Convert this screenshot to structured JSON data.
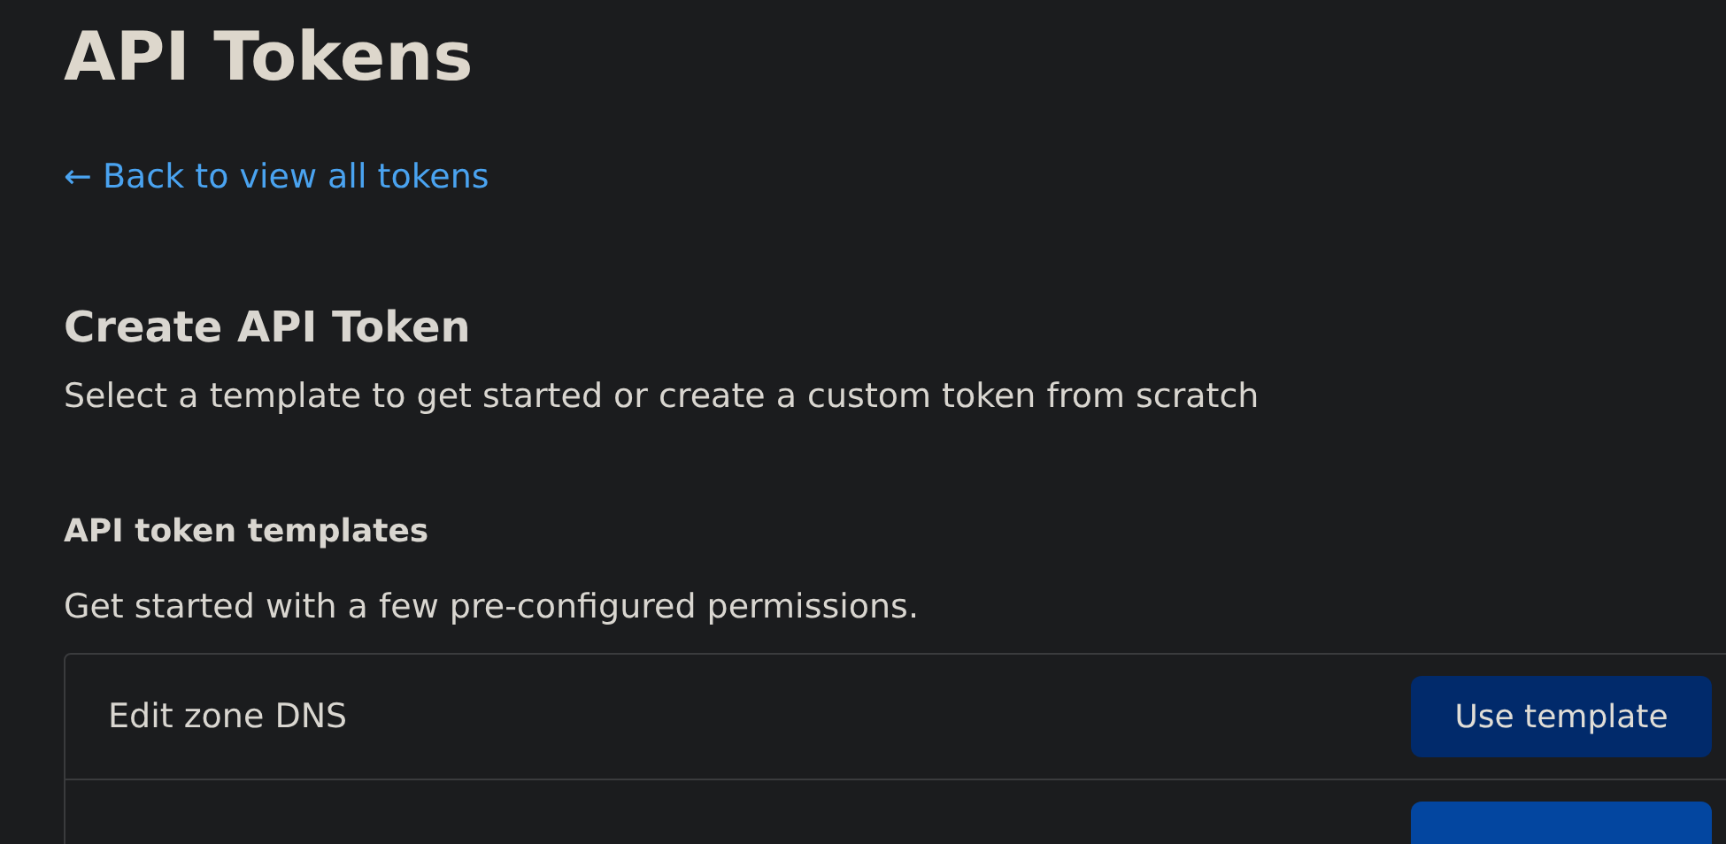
{
  "page": {
    "title": "API Tokens",
    "back_link": "← Back to view all tokens"
  },
  "create": {
    "heading": "Create API Token",
    "description": "Select a template to get started or create a custom token from scratch"
  },
  "templates": {
    "heading": "API token templates",
    "description": "Get started with a few pre-configured permissions.",
    "rows": [
      {
        "name": "Edit zone DNS",
        "button": {
          "label": "Use template",
          "hovered": true
        }
      },
      {
        "button": {
          "hovered": false
        }
      }
    ]
  }
}
